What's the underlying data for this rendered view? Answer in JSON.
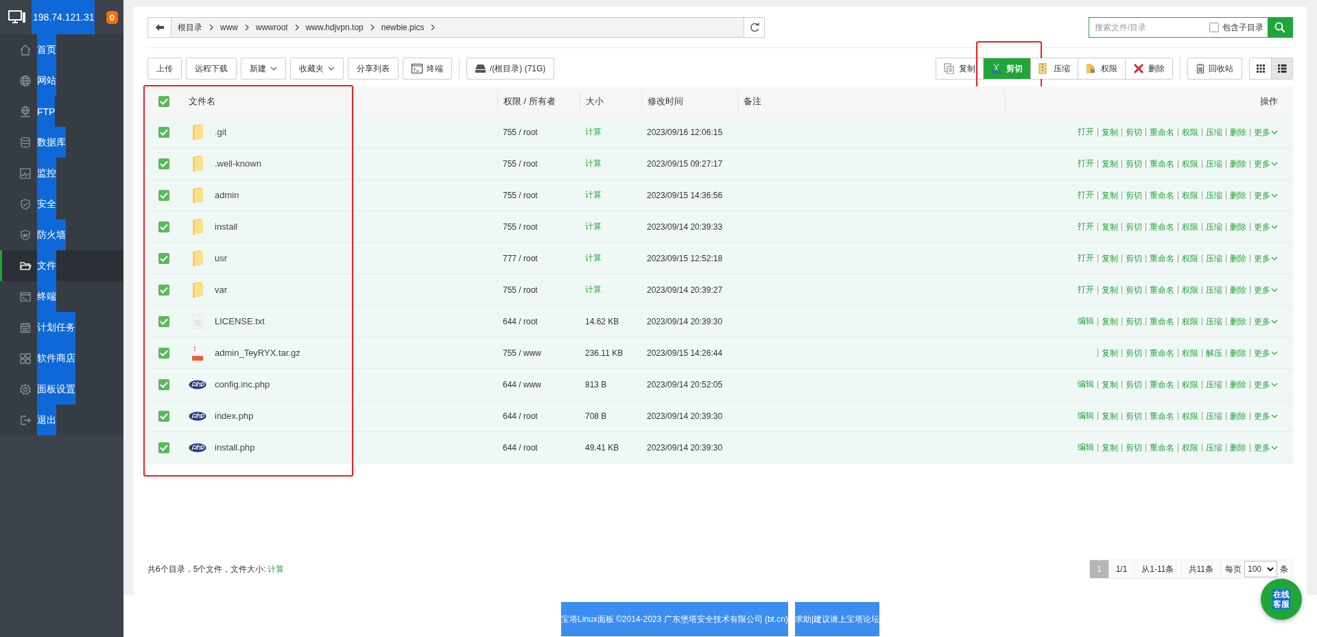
{
  "sidebar": {
    "host": "198.74.121.31",
    "badge": "0",
    "items": [
      {
        "label": "首页",
        "selected": false
      },
      {
        "label": "网站",
        "selected": false
      },
      {
        "label": "FTP",
        "selected": false
      },
      {
        "label": "数据库",
        "selected": false
      },
      {
        "label": "监控",
        "selected": false
      },
      {
        "label": "安全",
        "selected": false
      },
      {
        "label": "防火墙",
        "selected": false
      },
      {
        "label": "文件",
        "selected": true
      },
      {
        "label": "终端",
        "selected": false
      },
      {
        "label": "计划任务",
        "selected": false
      },
      {
        "label": "软件商店",
        "selected": false
      },
      {
        "label": "面板设置",
        "selected": false
      },
      {
        "label": "退出",
        "selected": false
      }
    ]
  },
  "path_bar": {
    "crumbs": [
      "根目录",
      "www",
      "wwwroot",
      "www.hdjvpn.top",
      "newbie.pics"
    ]
  },
  "search": {
    "placeholder": "搜索文件/目录",
    "include_sub_label": "包含子目录",
    "include_sub_checked": false
  },
  "toolbar_left": [
    {
      "label": "上传",
      "kind": "plain"
    },
    {
      "label": "远程下载",
      "kind": "plain"
    },
    {
      "label": "新建",
      "kind": "dropdown"
    },
    {
      "label": "收藏夹",
      "kind": "dropdown"
    },
    {
      "label": "分享列表",
      "kind": "plain"
    },
    {
      "label": "终端",
      "kind": "terminal"
    },
    {
      "label": "/(根目录) (71G)",
      "kind": "disk"
    }
  ],
  "toolbar_right": [
    {
      "label": "复制",
      "kind": "copy",
      "selected": false,
      "outlined": false
    },
    {
      "label": "剪切",
      "kind": "cut",
      "selected": true,
      "outlined": true
    },
    {
      "label": "压缩",
      "kind": "zip",
      "selected": false,
      "outlined": false
    },
    {
      "label": "权限",
      "kind": "permission",
      "selected": false,
      "outlined": false
    },
    {
      "label": "删除",
      "kind": "delete",
      "selected": false,
      "outlined": false
    }
  ],
  "recycle_bin": {
    "label": "回收站"
  },
  "view_modes": [
    {
      "kind": "grid",
      "selected": false
    },
    {
      "kind": "list",
      "selected": true
    }
  ],
  "table": {
    "all_checked": true,
    "name_column_outlined": true,
    "columns": [
      "文件名",
      "权限 / 所有者",
      "大小",
      "修改时间",
      "备注",
      "操作"
    ],
    "rows": [
      {
        "kind": "folder",
        "checked": true,
        "name": ".git",
        "perms": "755 / root",
        "size": "计算",
        "size_link": true,
        "time": "2023/09/16 12:06:15",
        "leading_separator": false,
        "actions": [
          "打开",
          "复制",
          "剪切",
          "重命名",
          "权限",
          "压缩",
          "删除",
          "更多"
        ]
      },
      {
        "kind": "folder",
        "checked": true,
        "name": ".well-known",
        "perms": "755 / root",
        "size": "计算",
        "size_link": true,
        "time": "2023/09/15 09:27:17",
        "leading_separator": false,
        "actions": [
          "打开",
          "复制",
          "剪切",
          "重命名",
          "权限",
          "压缩",
          "删除",
          "更多"
        ]
      },
      {
        "kind": "folder",
        "checked": true,
        "name": "admin",
        "perms": "755 / root",
        "size": "计算",
        "size_link": true,
        "time": "2023/09/15 14:36:56",
        "leading_separator": false,
        "actions": [
          "打开",
          "复制",
          "剪切",
          "重命名",
          "权限",
          "压缩",
          "删除",
          "更多"
        ]
      },
      {
        "kind": "folder",
        "checked": true,
        "name": "install",
        "perms": "755 / root",
        "size": "计算",
        "size_link": true,
        "time": "2023/09/14 20:39:33",
        "leading_separator": false,
        "actions": [
          "打开",
          "复制",
          "剪切",
          "重命名",
          "权限",
          "压缩",
          "删除",
          "更多"
        ]
      },
      {
        "kind": "folder",
        "checked": true,
        "name": "usr",
        "perms": "777 / root",
        "size": "计算",
        "size_link": true,
        "time": "2023/09/15 12:52:18",
        "leading_separator": false,
        "actions": [
          "打开",
          "复制",
          "剪切",
          "重命名",
          "权限",
          "压缩",
          "删除",
          "更多"
        ]
      },
      {
        "kind": "folder",
        "checked": true,
        "name": "var",
        "perms": "755 / root",
        "size": "计算",
        "size_link": true,
        "time": "2023/09/14 20:39:27",
        "leading_separator": false,
        "actions": [
          "打开",
          "复制",
          "剪切",
          "重命名",
          "权限",
          "压缩",
          "删除",
          "更多"
        ]
      },
      {
        "kind": "text",
        "checked": true,
        "name": "LICENSE.txt",
        "perms": "644 / root",
        "size": "14.62 KB",
        "size_link": false,
        "time": "2023/09/14 20:39:30",
        "leading_separator": false,
        "actions": [
          "编辑",
          "复制",
          "剪切",
          "重命名",
          "权限",
          "压缩",
          "删除",
          "更多"
        ]
      },
      {
        "kind": "archive",
        "checked": true,
        "name": "admin_TeyRYX.tar.gz",
        "perms": "755 / www",
        "size": "236.11 KB",
        "size_link": false,
        "time": "2023/09/15 14:26:44",
        "leading_separator": true,
        "actions": [
          "复制",
          "剪切",
          "重命名",
          "权限",
          "解压",
          "删除",
          "更多"
        ]
      },
      {
        "kind": "php",
        "checked": true,
        "name": "config.inc.php",
        "perms": "644 / www",
        "size": "813 B",
        "size_link": false,
        "time": "2023/09/14 20:52:05",
        "leading_separator": false,
        "actions": [
          "编辑",
          "复制",
          "剪切",
          "重命名",
          "权限",
          "压缩",
          "删除",
          "更多"
        ]
      },
      {
        "kind": "php",
        "checked": true,
        "name": "index.php",
        "perms": "644 / root",
        "size": "708 B",
        "size_link": false,
        "time": "2023/09/14 20:39:30",
        "leading_separator": false,
        "actions": [
          "编辑",
          "复制",
          "剪切",
          "重命名",
          "权限",
          "压缩",
          "删除",
          "更多"
        ]
      },
      {
        "kind": "php",
        "checked": true,
        "name": "install.php",
        "perms": "644 / root",
        "size": "49.41 KB",
        "size_link": false,
        "time": "2023/09/14 20:39:30",
        "leading_separator": false,
        "actions": [
          "编辑",
          "复制",
          "剪切",
          "重命名",
          "权限",
          "压缩",
          "删除",
          "更多"
        ]
      }
    ]
  },
  "summary": {
    "text": "共6个目录，5个文件，文件大小:",
    "link": "计算"
  },
  "pagination": {
    "pages": [
      {
        "label": "1",
        "selected": true
      }
    ],
    "page_of": "1/1",
    "range": "从1-11条",
    "total": "共11条",
    "per_page_label": "每页",
    "per_page": "100",
    "unit": "条"
  },
  "footer": {
    "copyright": "宝塔Linux面板 ©2014-2023 广东堡塔安全技术有限公司 (bt.cn)",
    "forum": "求助|建议请上宝塔论坛"
  },
  "chat_button": {
    "label": "在线客服"
  }
}
